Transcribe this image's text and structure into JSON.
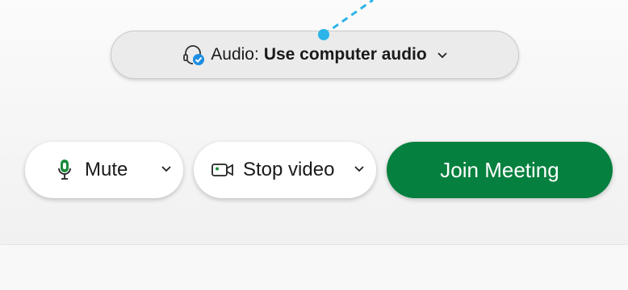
{
  "audio": {
    "prefix": "Audio:",
    "value": "Use computer audio"
  },
  "controls": {
    "mute_label": "Mute",
    "video_label": "Stop video",
    "join_label": "Join Meeting"
  },
  "colors": {
    "join_green": "#05803e",
    "callout_blue": "#2bb4e8",
    "mic_green": "#1a8b3a"
  },
  "icons": {
    "audio": "headset-check-icon",
    "mic": "microphone-icon",
    "video": "video-camera-icon",
    "dropdown": "chevron-down-icon"
  }
}
